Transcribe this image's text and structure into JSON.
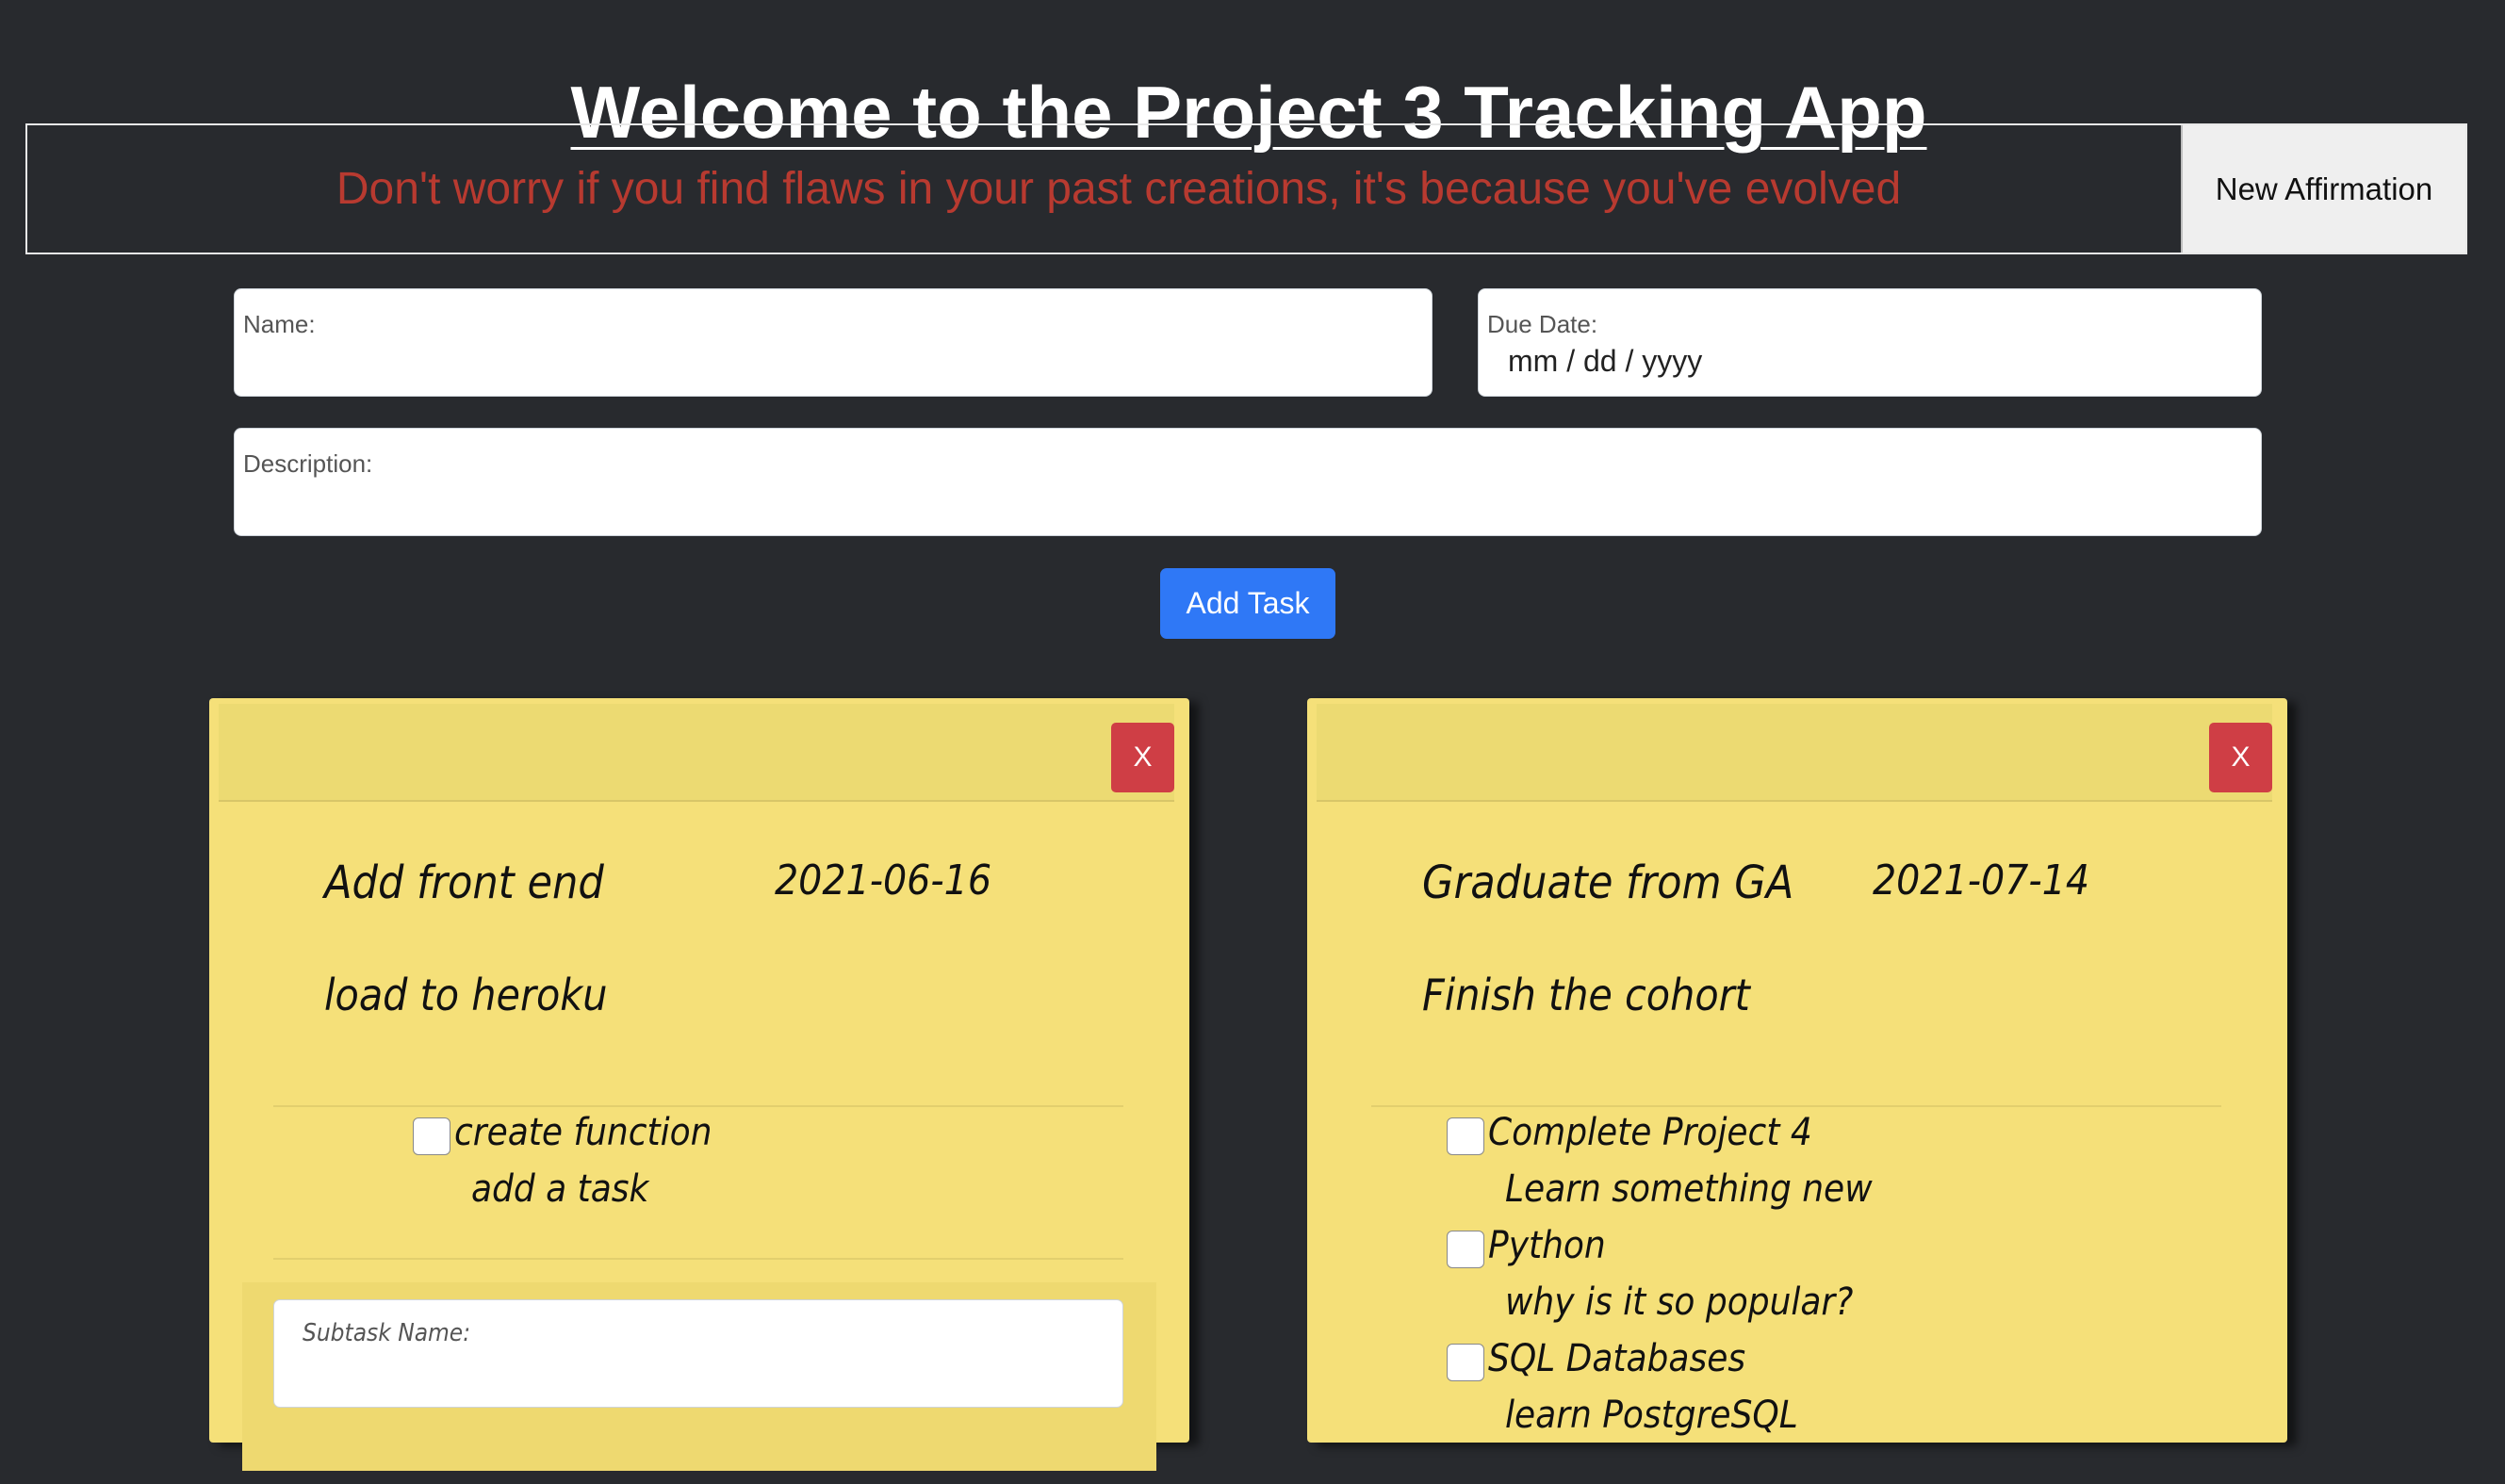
{
  "header": {
    "title": "Welcome to the Project 3 Tracking App"
  },
  "affirmation": {
    "text": "Don't worry if you find flaws in your past creations, it's because you've evolved",
    "button_label": "New Affirmation"
  },
  "form": {
    "name_label": "Name:",
    "due_label": "Due Date:",
    "due_placeholder": "mm / dd / yyyy",
    "description_label": "Description:",
    "add_button": "Add Task"
  },
  "cards": [
    {
      "close_label": "X",
      "name": "Add front end",
      "date": "2021-06-16",
      "description": "load to heroku",
      "subtasks": [
        {
          "name": "create function",
          "description": "add a task"
        }
      ],
      "subtask_label": "Subtask Name:"
    },
    {
      "close_label": "X",
      "name": "Graduate from GA",
      "date": "2021-07-14",
      "description": "Finish the cohort",
      "subtasks": [
        {
          "name": "Complete Project 4",
          "description": "Learn something new"
        },
        {
          "name": "Python",
          "description": "why is it so popular?"
        },
        {
          "name": "SQL Databases",
          "description": "learn PostgreSQL"
        }
      ]
    }
  ],
  "colors": {
    "background": "#282a2e",
    "affirmation_text": "#b83a30",
    "primary_button": "#2f78f6",
    "danger_button": "#cf3e45",
    "sticky_note": "#f5e079"
  }
}
